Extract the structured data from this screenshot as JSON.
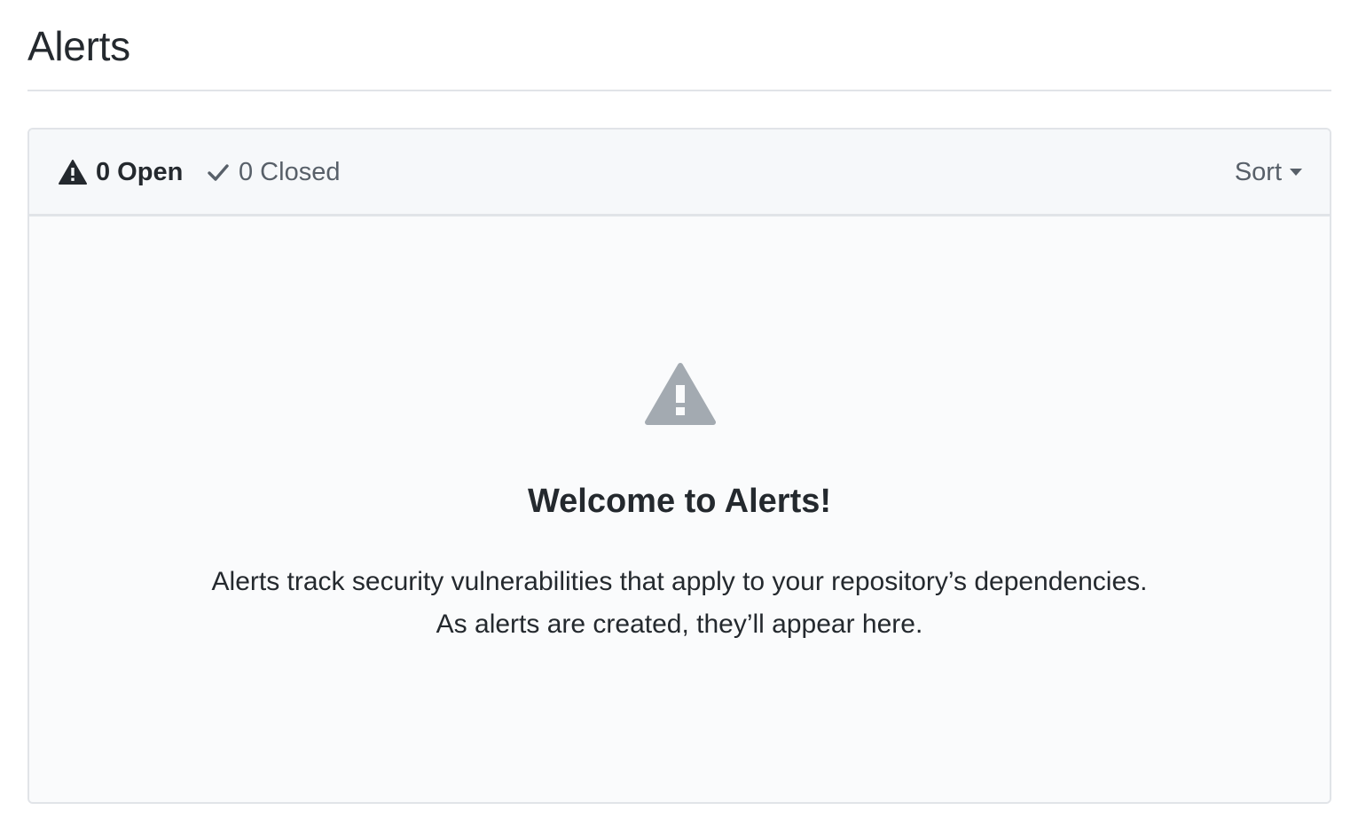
{
  "page": {
    "title": "Alerts"
  },
  "tabs": {
    "open_label": "0 Open",
    "closed_label": "0 Closed"
  },
  "sort": {
    "label": "Sort"
  },
  "blankslate": {
    "title": "Welcome to Alerts!",
    "line1": "Alerts track security vulnerabilities that apply to your repository’s dependencies.",
    "line2": "As alerts are created, they’ll appear here."
  },
  "colors": {
    "text_primary": "#24292e",
    "text_muted": "#586069",
    "border": "#e1e4e8",
    "header_bg": "#f6f8fa",
    "blank_icon": "#a3aab1"
  },
  "icons": {
    "open_icon": "alert-icon",
    "closed_icon": "check-icon",
    "sort_caret": "caret-down-icon",
    "blank_icon": "alert-icon"
  }
}
